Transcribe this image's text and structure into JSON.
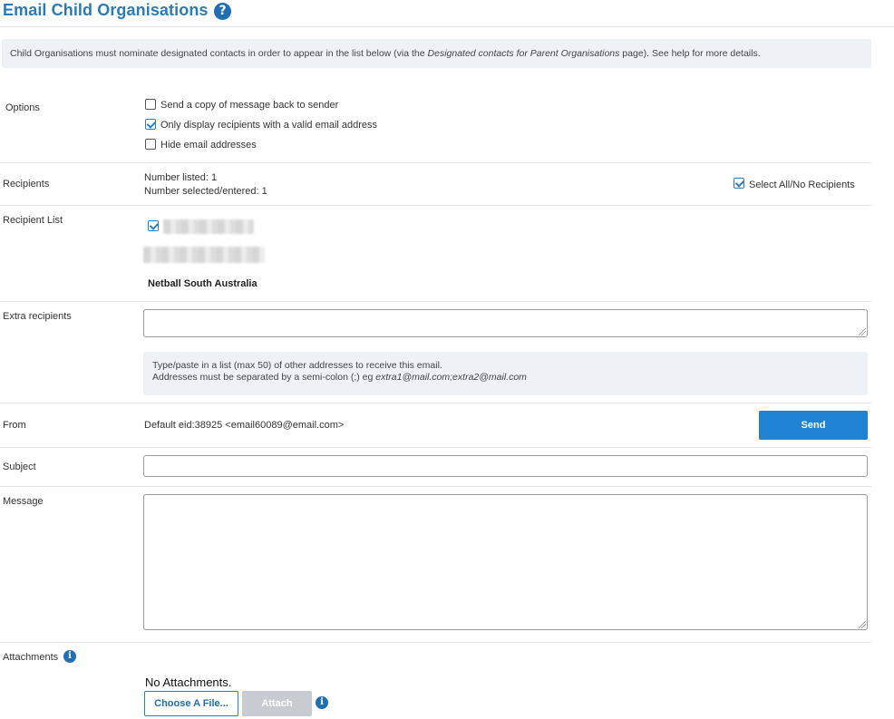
{
  "header": {
    "title": "Email Child Organisations",
    "help_icon": "question-circle-icon"
  },
  "notice": {
    "prefix": "Child Organisations must nominate designated contacts in order to appear in the list below (via the ",
    "link_text": "Designated contacts for Parent Organisations",
    "suffix": " page). See help for more details."
  },
  "options": {
    "label": "Options",
    "items": [
      {
        "label": "Send a copy of message back to sender",
        "checked": false
      },
      {
        "label": "Only display recipients with a valid email address",
        "checked": true
      },
      {
        "label": "Hide email addresses",
        "checked": false
      }
    ]
  },
  "recipients": {
    "label": "Recipients",
    "number_listed": "Number listed: 1",
    "number_selected": "Number selected/entered: 1",
    "select_all_label": "Select All/No Recipients",
    "select_all_checked": true
  },
  "recipient_list": {
    "label": "Recipient List",
    "item_checked": true,
    "organisation": "Netball South Australia"
  },
  "extra_recipients": {
    "label": "Extra recipients",
    "value": "",
    "hint_line1": "Type/paste in a list (max 50) of other addresses to receive this email.",
    "hint_line2_prefix": "Addresses must be separated by a semi-colon (;) eg ",
    "hint_line2_example": "extra1@mail.com;extra2@mail.com"
  },
  "from": {
    "label": "From",
    "value": "Default eid:38925 <email60089@email.com>",
    "send_label": "Send"
  },
  "subject": {
    "label": "Subject",
    "value": ""
  },
  "message": {
    "label": "Message",
    "value": ""
  },
  "attachments": {
    "label": "Attachments",
    "status": "No Attachments.",
    "choose_label": "Choose A File...",
    "attach_label": "Attach",
    "info_icon": "info-circle-icon"
  },
  "colors": {
    "accent": "#1f82d2",
    "title": "#2b7bb9",
    "panel": "#eef2f6"
  }
}
